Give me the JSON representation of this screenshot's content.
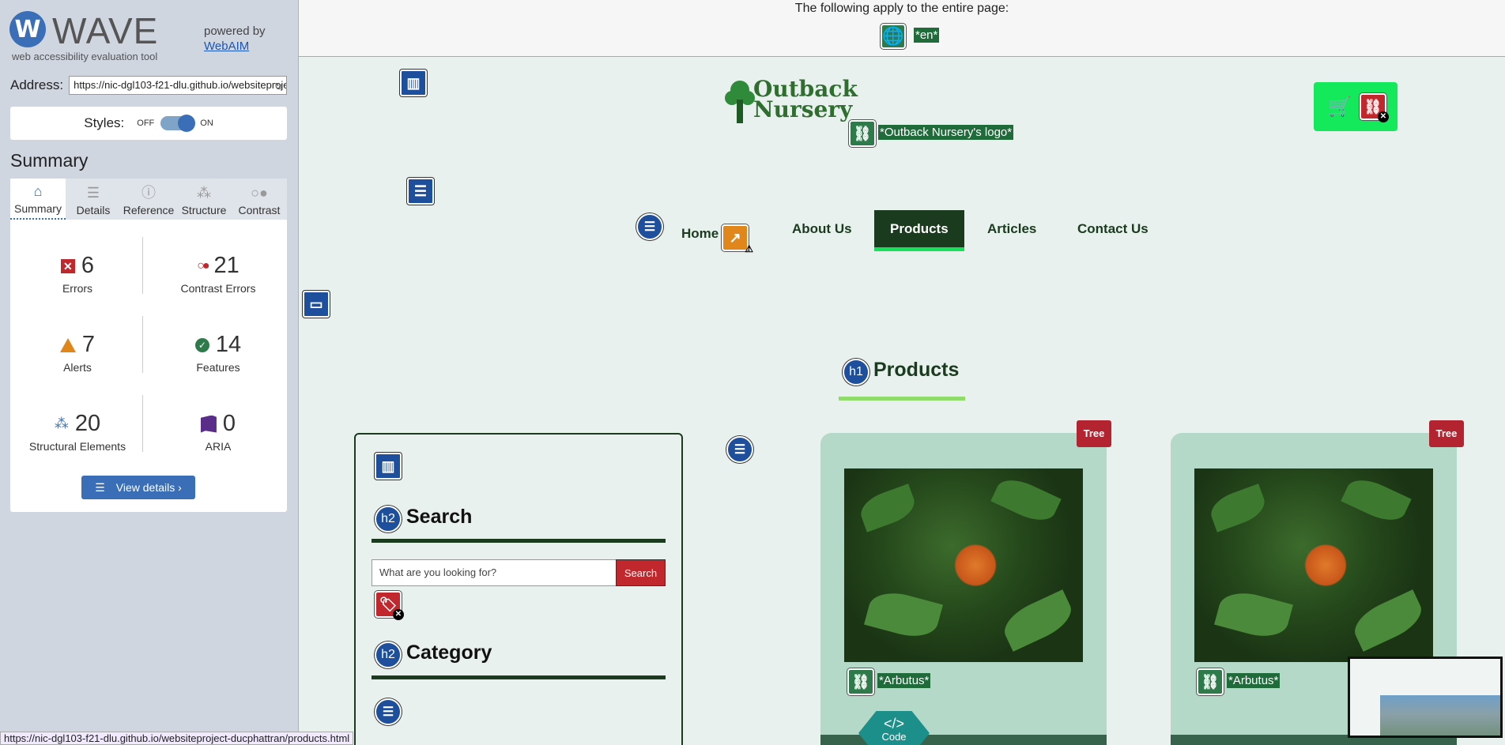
{
  "wave": {
    "logo_letter": "W",
    "title": "WAVE",
    "subtitle": "web accessibility evaluation tool",
    "powered_by": "powered by",
    "webaim": "WebAIM",
    "address_label": "Address:",
    "address_value": "https://nic-dgl103-f21-dlu.github.io/websiteproject-ducphattran/products.html",
    "styles_label": "Styles:",
    "styles_off": "OFF",
    "styles_on": "ON",
    "summary_heading": "Summary",
    "tabs": [
      {
        "label": "Summary",
        "icon": "home-icon"
      },
      {
        "label": "Details",
        "icon": "list-icon"
      },
      {
        "label": "Reference",
        "icon": "info-icon"
      },
      {
        "label": "Structure",
        "icon": "hierarchy-icon"
      },
      {
        "label": "Contrast",
        "icon": "contrast-icon"
      }
    ],
    "stats": {
      "errors": {
        "count": "6",
        "label": "Errors"
      },
      "contrast": {
        "count": "21",
        "label": "Contrast Errors"
      },
      "alerts": {
        "count": "7",
        "label": "Alerts"
      },
      "features": {
        "count": "14",
        "label": "Features"
      },
      "structural": {
        "count": "20",
        "label": "Structural Elements"
      },
      "aria": {
        "count": "0",
        "label": "ARIA"
      }
    },
    "view_details": "View details ›",
    "status_url": "https://nic-dgl103-f21-dlu.github.io/websiteproject-ducphattran/products.html"
  },
  "page": {
    "global_note": "The following apply to the entire page:",
    "lang_tag": "*en*",
    "logo_line1": "Outback",
    "logo_line2": "Nursery",
    "logo_alt_tag": "*Outback Nursery's logo*",
    "nav": [
      "Home",
      "About Us",
      "Products",
      "Articles",
      "Contact Us"
    ],
    "active_nav": "Products",
    "h1_badge": "h1",
    "h1": "Products",
    "h2_badge": "h2",
    "search_heading": "Search",
    "search_placeholder": "What are you looking for?",
    "search_button": "Search",
    "category_heading": "Category",
    "cards": [
      {
        "badge": "Tree",
        "alt_tag": "*Arbutus*"
      },
      {
        "badge": "Tree",
        "alt_tag": "*Arbutus*"
      }
    ],
    "code_label": "Code",
    "code_symbol": "</>"
  },
  "colors": {
    "wave_blue": "#3a6fb8",
    "error_red": "#c0282d",
    "alert_orange": "#e0861a",
    "feature_green": "#2f7a4a",
    "nav_dark_green": "#1b3b1f",
    "cart_green": "#14e85b",
    "card_bg": "#b5d9c9"
  }
}
